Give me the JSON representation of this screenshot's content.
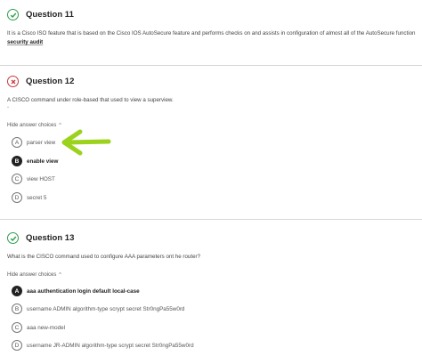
{
  "q11": {
    "title": "Question 11",
    "text": "It is a Cisco ISO feature that is based on the Cisco IOS AutoSecure feature and performs checks on and assists in configuration of almost all of the AutoSecure function",
    "answer_line": "security audit"
  },
  "q12": {
    "title": "Question 12",
    "text": "A CISCO command under role-based that used to view a superview.",
    "dash": "-",
    "hide_label": "Hide answer choices",
    "hide_caret": "^",
    "choices": [
      {
        "letter": "A",
        "text": "parser view"
      },
      {
        "letter": "B",
        "text": "enable view"
      },
      {
        "letter": "C",
        "text": "view HOST"
      },
      {
        "letter": "D",
        "text": "secret 5"
      }
    ]
  },
  "q13": {
    "title": "Question 13",
    "text": "What is the CISCO command used to configure AAA parameters ont he router?",
    "hide_label": "Hide answer choices",
    "hide_caret": "^",
    "choices": [
      {
        "letter": "A",
        "text": "aaa authentication login default local-case"
      },
      {
        "letter": "B",
        "text": "username ADMIN algorithm-type scrypt secret Str0ngPa55w0rd"
      },
      {
        "letter": "C",
        "text": "aaa new-model"
      },
      {
        "letter": "D",
        "text": "username JR-ADMIN algorithm-type scrypt secret Str0ngPa55w0rd"
      }
    ]
  },
  "colors": {
    "correct": "#2e9e4b",
    "wrong": "#c8383c",
    "arrow": "#9ad21c"
  },
  "icons": [
    "check-circle-icon",
    "x-circle-icon",
    "caret-up-icon",
    "arrow-left-icon"
  ]
}
